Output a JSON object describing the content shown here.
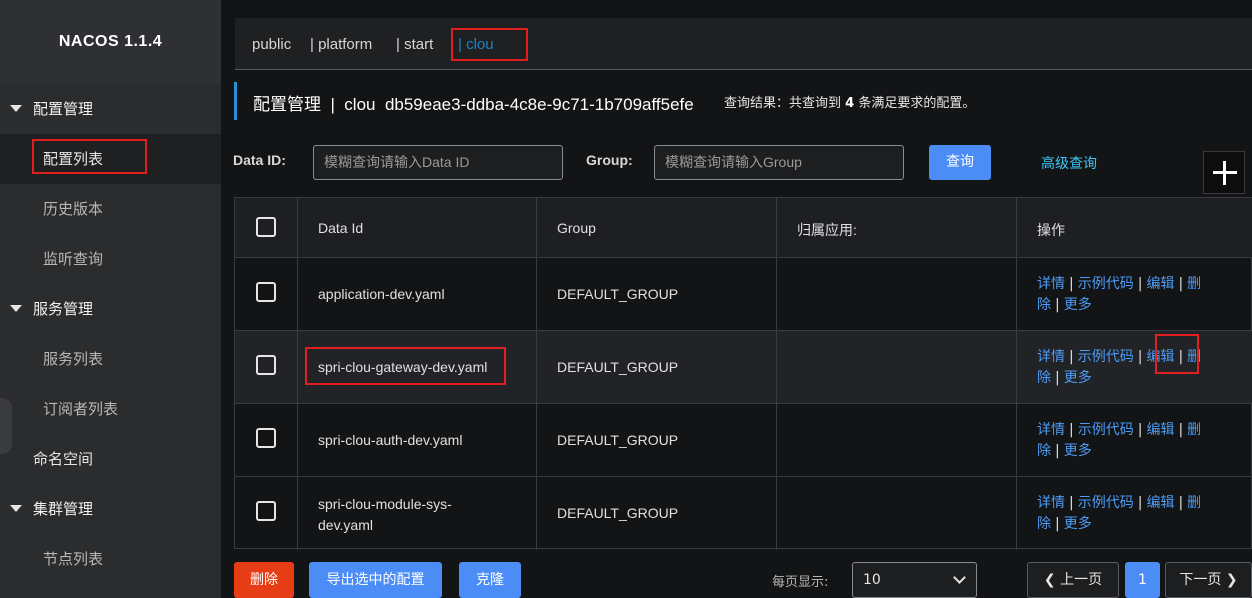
{
  "app": {
    "title": "NACOS 1.1.4"
  },
  "sidebar": {
    "groups": [
      {
        "label": "配置管理",
        "items": [
          "配置列表",
          "历史版本",
          "监听查询"
        ]
      },
      {
        "label": "服务管理",
        "items": [
          "服务列表",
          "订阅者列表"
        ]
      },
      {
        "label": "命名空间"
      },
      {
        "label": "集群管理",
        "items": [
          "节点列表"
        ]
      }
    ]
  },
  "namespaces": {
    "items": [
      "public",
      "| platform",
      "| start",
      "| clou"
    ],
    "current": "clou"
  },
  "header": {
    "title": "配置管理  |  clou  db59eae3-ddba-4c8e-9c71-1b709aff5efe",
    "result_prefix": "查询结果：共查询到 ",
    "result_count": "4",
    "result_suffix": " 条满足要求的配置。"
  },
  "search": {
    "dataid_label": "Data ID:",
    "dataid_placeholder": "模糊查询请输入Data ID",
    "group_label": "Group:",
    "group_placeholder": "模糊查询请输入Group",
    "query_button": "查询",
    "advanced_link": "高级查询"
  },
  "table": {
    "headers": [
      "Data Id",
      "Group",
      "归属应用:",
      "操作"
    ],
    "rows": [
      {
        "data_id": "application-dev.yaml",
        "group": "DEFAULT_GROUP",
        "app": ""
      },
      {
        "data_id": "spri-clou-gateway-dev.yaml",
        "group": "DEFAULT_GROUP",
        "app": ""
      },
      {
        "data_id": "spri-clou-auth-dev.yaml",
        "group": "DEFAULT_GROUP",
        "app": ""
      },
      {
        "data_id": "spri-clou-module-sys-dev.yaml",
        "data_id_line1": "spri-clou-module-sys-",
        "data_id_line2": "dev.yaml",
        "group": "DEFAULT_GROUP",
        "app": ""
      }
    ],
    "ops": {
      "detail": "详情",
      "sample": "示例代码",
      "edit": "编辑",
      "delete_a": "删",
      "delete_b": "除",
      "more": "更多",
      "sep": "|"
    }
  },
  "footer": {
    "delete_button": "删除",
    "export_button": "导出选中的配置",
    "clone_button": "克隆",
    "per_page_label": "每页显示:",
    "per_page_value": "10",
    "prev_label": "上一页",
    "current_page": "1",
    "next_label": "下一页"
  },
  "colors": {
    "accent": "#4c8cf7",
    "link": "#4d9cf5",
    "danger": "#e73d16",
    "highlight_box": "#e02020"
  }
}
